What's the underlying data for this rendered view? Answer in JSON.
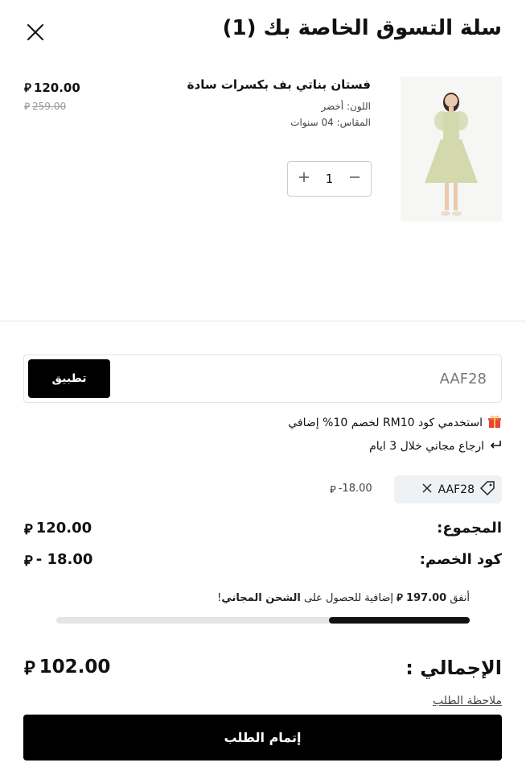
{
  "header": {
    "title": "سلة التسوق الخاصة بك (1)"
  },
  "currency_symbol": "⃁",
  "item": {
    "name": "فستان بناتي بف بكسرات سادة",
    "price": "120.00",
    "old_price": "259.00",
    "color_label": "اللون:",
    "color_value": "أخضر",
    "size_label": "المقاس:",
    "size_value": "04 سنوات",
    "quantity": "1"
  },
  "coupon": {
    "value": "AAF28",
    "apply_label": "تطبيق"
  },
  "promo": {
    "offer_text": "استخدمي كود RM10 لخصم 10% إضافي",
    "return_text": "ارجاع مجاني خلال 3 ايام"
  },
  "applied_coupon": {
    "code": "AAF28",
    "discount": "-18.00"
  },
  "summary": {
    "subtotal_label": "المجموع:",
    "subtotal_value": "120.00",
    "discount_label": "كود الخصم:",
    "discount_value": "- 18.00",
    "shipping_prefix": "أنفق",
    "shipping_amount": "197.00",
    "shipping_middle": "إضافية للحصول على",
    "shipping_bold": "الشحن المجاني",
    "shipping_suffix": "!",
    "shipping_progress": 0.34,
    "total_label": "الإجمالي :",
    "total_value": "102.00",
    "order_note_label": "ملاحظة الطلب"
  },
  "checkout": {
    "label": "إتمام الطلب"
  }
}
